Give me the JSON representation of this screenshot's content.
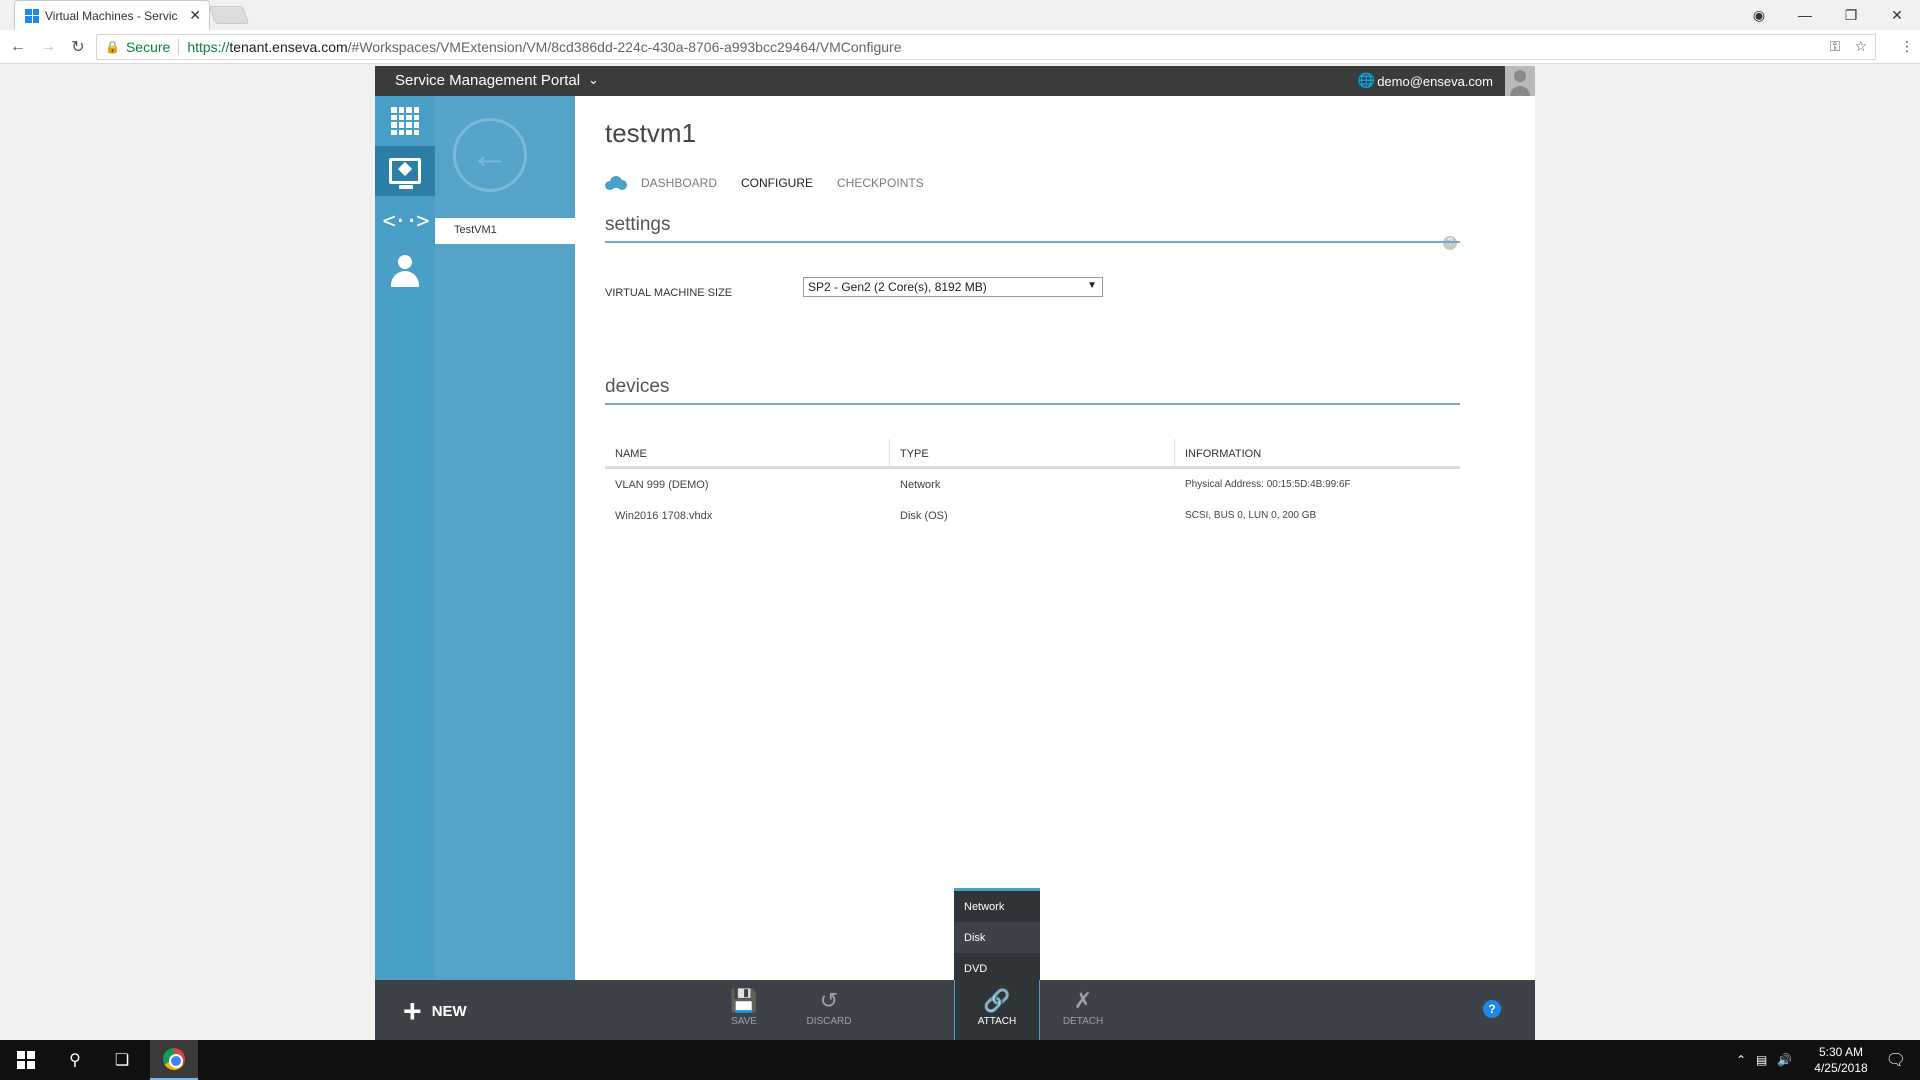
{
  "browser": {
    "tab_title": "Virtual Machines - Servic",
    "tab_close": "✕",
    "secure_label": "Secure",
    "url_scheme": "https://",
    "url_host": "tenant.enseva.com",
    "url_path": "/#Workspaces/VMExtension/VM/8cd386dd-224c-430a-8706-a993bcc29464/VMConfigure"
  },
  "portal": {
    "brand": "Service Management Portal",
    "user_email": "demo@enseva.com"
  },
  "secondary_nav": {
    "items": [
      {
        "label": "TestVM1"
      }
    ]
  },
  "vm": {
    "title": "testvm1",
    "tabs": [
      {
        "label": "DASHBOARD",
        "active": false
      },
      {
        "label": "CONFIGURE",
        "active": true
      },
      {
        "label": "CHECKPOINTS",
        "active": false
      }
    ]
  },
  "settings": {
    "section_title": "settings",
    "size_label": "VIRTUAL MACHINE SIZE",
    "size_value": "SP2 - Gen2 (2 Core(s), 8192 MB)"
  },
  "devices": {
    "section_title": "devices",
    "columns": [
      "NAME",
      "TYPE",
      "INFORMATION"
    ],
    "rows": [
      {
        "name": "VLAN 999 (DEMO)",
        "type": "Network",
        "info": "Physical Address: 00:15:5D:4B:99:6F"
      },
      {
        "name": "Win2016 1708.vhdx",
        "type": "Disk (OS)",
        "info": "SCSI, BUS 0, LUN 0, 200 GB"
      }
    ]
  },
  "commandbar": {
    "new_label": "NEW",
    "save": "SAVE",
    "discard": "DISCARD",
    "attach": "ATTACH",
    "detach": "DETACH",
    "help": "?"
  },
  "attach_menu": {
    "items": [
      "Network",
      "Disk",
      "DVD"
    ]
  },
  "taskbar": {
    "time": "5:30 AM",
    "date": "4/25/2018"
  },
  "colors": {
    "rail": "#4a9fc7",
    "secondary": "#55a3c9",
    "commandbar": "#3d4249",
    "topbar": "#3b3b3b"
  }
}
